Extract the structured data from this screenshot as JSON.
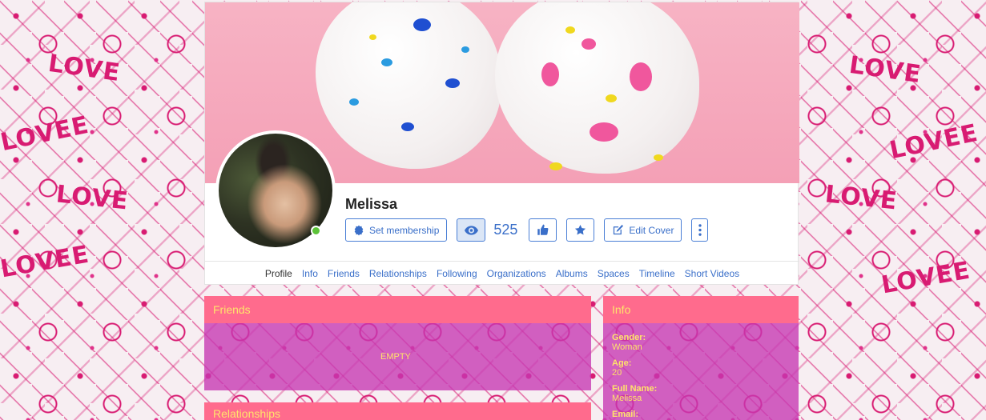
{
  "background": {
    "pattern_word": "LOVE",
    "pattern_word_alt": "LOVEE"
  },
  "profile": {
    "name": "Melissa",
    "online": true,
    "views": "525"
  },
  "actions": {
    "membership_label": "Set membership",
    "edit_cover_label": "Edit Cover"
  },
  "tabs": [
    {
      "label": "Profile",
      "active": true
    },
    {
      "label": "Info"
    },
    {
      "label": "Friends"
    },
    {
      "label": "Relationships"
    },
    {
      "label": "Following"
    },
    {
      "label": "Organizations"
    },
    {
      "label": "Albums"
    },
    {
      "label": "Spaces"
    },
    {
      "label": "Timeline"
    },
    {
      "label": "Short Videos"
    }
  ],
  "friends_panel": {
    "title": "Friends",
    "empty_text": "EMPTY"
  },
  "relationships_panel": {
    "title": "Relationships"
  },
  "info_panel": {
    "title": "Info",
    "rows": [
      {
        "label": "Gender:",
        "value": "Woman"
      },
      {
        "label": "Age:",
        "value": "20"
      },
      {
        "label": "Full Name:",
        "value": "Melissa"
      },
      {
        "label": "Email:",
        "value": ""
      }
    ]
  },
  "colors": {
    "panel_header": "#ff6b8d",
    "panel_body": "#c637b2",
    "accent_text": "#ffe36b",
    "link": "#3a6fc9",
    "online": "#5cc238"
  },
  "icons": [
    "badge-icon",
    "eye-icon",
    "thumbs-up-icon",
    "star-icon",
    "edit-icon",
    "more-vertical-icon"
  ]
}
